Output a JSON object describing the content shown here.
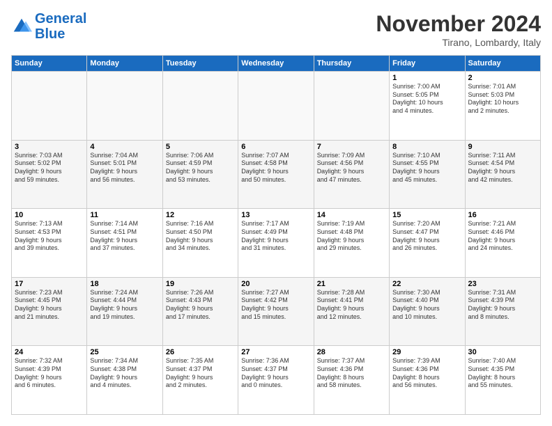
{
  "header": {
    "logo_line1": "General",
    "logo_line2": "Blue",
    "month": "November 2024",
    "location": "Tirano, Lombardy, Italy"
  },
  "days_header": [
    "Sunday",
    "Monday",
    "Tuesday",
    "Wednesday",
    "Thursday",
    "Friday",
    "Saturday"
  ],
  "weeks": [
    [
      {
        "day": "",
        "info": ""
      },
      {
        "day": "",
        "info": ""
      },
      {
        "day": "",
        "info": ""
      },
      {
        "day": "",
        "info": ""
      },
      {
        "day": "",
        "info": ""
      },
      {
        "day": "1",
        "info": "Sunrise: 7:00 AM\nSunset: 5:05 PM\nDaylight: 10 hours\nand 4 minutes."
      },
      {
        "day": "2",
        "info": "Sunrise: 7:01 AM\nSunset: 5:03 PM\nDaylight: 10 hours\nand 2 minutes."
      }
    ],
    [
      {
        "day": "3",
        "info": "Sunrise: 7:03 AM\nSunset: 5:02 PM\nDaylight: 9 hours\nand 59 minutes."
      },
      {
        "day": "4",
        "info": "Sunrise: 7:04 AM\nSunset: 5:01 PM\nDaylight: 9 hours\nand 56 minutes."
      },
      {
        "day": "5",
        "info": "Sunrise: 7:06 AM\nSunset: 4:59 PM\nDaylight: 9 hours\nand 53 minutes."
      },
      {
        "day": "6",
        "info": "Sunrise: 7:07 AM\nSunset: 4:58 PM\nDaylight: 9 hours\nand 50 minutes."
      },
      {
        "day": "7",
        "info": "Sunrise: 7:09 AM\nSunset: 4:56 PM\nDaylight: 9 hours\nand 47 minutes."
      },
      {
        "day": "8",
        "info": "Sunrise: 7:10 AM\nSunset: 4:55 PM\nDaylight: 9 hours\nand 45 minutes."
      },
      {
        "day": "9",
        "info": "Sunrise: 7:11 AM\nSunset: 4:54 PM\nDaylight: 9 hours\nand 42 minutes."
      }
    ],
    [
      {
        "day": "10",
        "info": "Sunrise: 7:13 AM\nSunset: 4:53 PM\nDaylight: 9 hours\nand 39 minutes."
      },
      {
        "day": "11",
        "info": "Sunrise: 7:14 AM\nSunset: 4:51 PM\nDaylight: 9 hours\nand 37 minutes."
      },
      {
        "day": "12",
        "info": "Sunrise: 7:16 AM\nSunset: 4:50 PM\nDaylight: 9 hours\nand 34 minutes."
      },
      {
        "day": "13",
        "info": "Sunrise: 7:17 AM\nSunset: 4:49 PM\nDaylight: 9 hours\nand 31 minutes."
      },
      {
        "day": "14",
        "info": "Sunrise: 7:19 AM\nSunset: 4:48 PM\nDaylight: 9 hours\nand 29 minutes."
      },
      {
        "day": "15",
        "info": "Sunrise: 7:20 AM\nSunset: 4:47 PM\nDaylight: 9 hours\nand 26 minutes."
      },
      {
        "day": "16",
        "info": "Sunrise: 7:21 AM\nSunset: 4:46 PM\nDaylight: 9 hours\nand 24 minutes."
      }
    ],
    [
      {
        "day": "17",
        "info": "Sunrise: 7:23 AM\nSunset: 4:45 PM\nDaylight: 9 hours\nand 21 minutes."
      },
      {
        "day": "18",
        "info": "Sunrise: 7:24 AM\nSunset: 4:44 PM\nDaylight: 9 hours\nand 19 minutes."
      },
      {
        "day": "19",
        "info": "Sunrise: 7:26 AM\nSunset: 4:43 PM\nDaylight: 9 hours\nand 17 minutes."
      },
      {
        "day": "20",
        "info": "Sunrise: 7:27 AM\nSunset: 4:42 PM\nDaylight: 9 hours\nand 15 minutes."
      },
      {
        "day": "21",
        "info": "Sunrise: 7:28 AM\nSunset: 4:41 PM\nDaylight: 9 hours\nand 12 minutes."
      },
      {
        "day": "22",
        "info": "Sunrise: 7:30 AM\nSunset: 4:40 PM\nDaylight: 9 hours\nand 10 minutes."
      },
      {
        "day": "23",
        "info": "Sunrise: 7:31 AM\nSunset: 4:39 PM\nDaylight: 9 hours\nand 8 minutes."
      }
    ],
    [
      {
        "day": "24",
        "info": "Sunrise: 7:32 AM\nSunset: 4:39 PM\nDaylight: 9 hours\nand 6 minutes."
      },
      {
        "day": "25",
        "info": "Sunrise: 7:34 AM\nSunset: 4:38 PM\nDaylight: 9 hours\nand 4 minutes."
      },
      {
        "day": "26",
        "info": "Sunrise: 7:35 AM\nSunset: 4:37 PM\nDaylight: 9 hours\nand 2 minutes."
      },
      {
        "day": "27",
        "info": "Sunrise: 7:36 AM\nSunset: 4:37 PM\nDaylight: 9 hours\nand 0 minutes."
      },
      {
        "day": "28",
        "info": "Sunrise: 7:37 AM\nSunset: 4:36 PM\nDaylight: 8 hours\nand 58 minutes."
      },
      {
        "day": "29",
        "info": "Sunrise: 7:39 AM\nSunset: 4:36 PM\nDaylight: 8 hours\nand 56 minutes."
      },
      {
        "day": "30",
        "info": "Sunrise: 7:40 AM\nSunset: 4:35 PM\nDaylight: 8 hours\nand 55 minutes."
      }
    ]
  ]
}
